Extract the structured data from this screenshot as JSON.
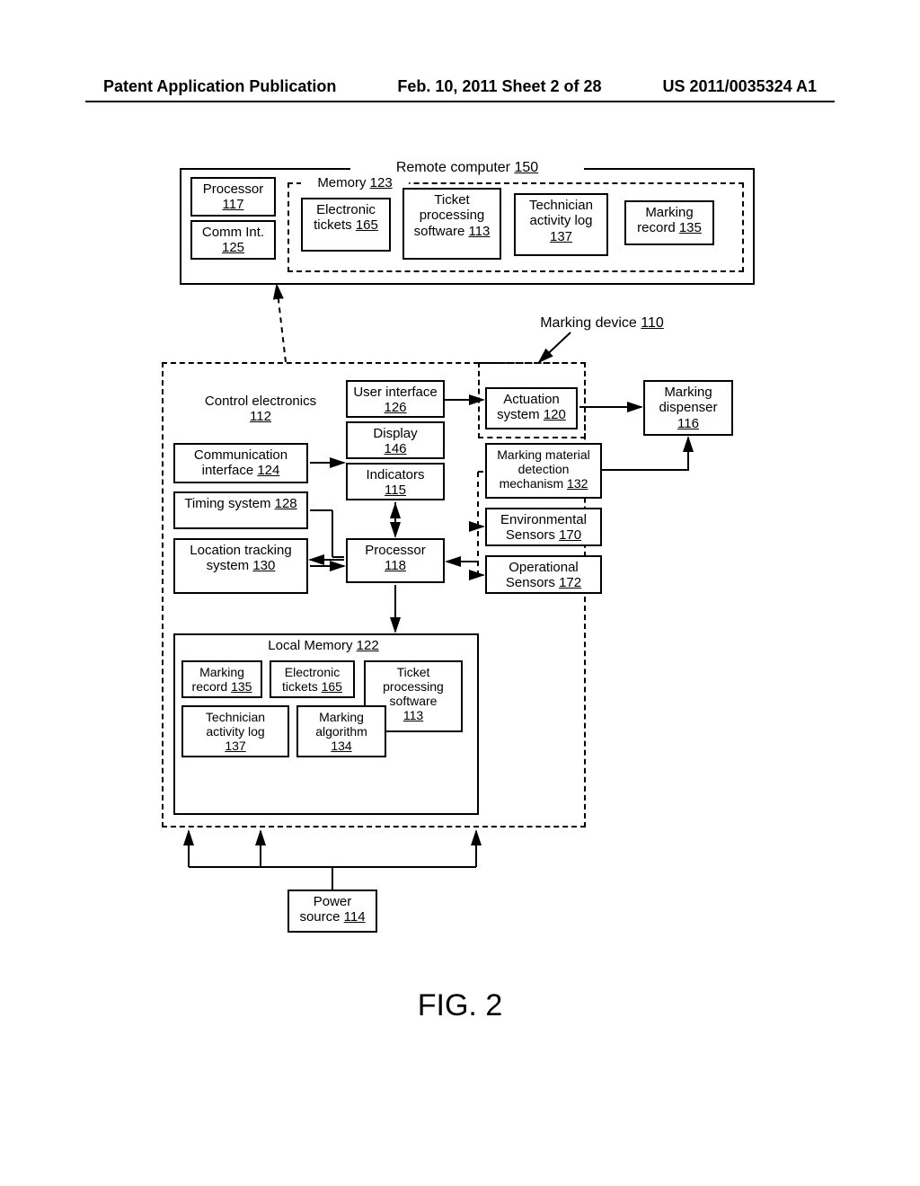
{
  "header": {
    "left": "Patent Application Publication",
    "center": "Feb. 10, 2011  Sheet 2 of 28",
    "right": "US 2011/0035324 A1"
  },
  "remote": {
    "title": "Remote computer ",
    "title_ref": "150",
    "processor": "Processor",
    "processor_ref": "117",
    "comm": "Comm Int.",
    "comm_ref": "125",
    "memory": "Memory ",
    "memory_ref": "123",
    "etickets": "Electronic tickets ",
    "etickets_ref": "165",
    "tps": "Ticket processing software ",
    "tps_ref": "113",
    "tal": "Technician activity log ",
    "tal_ref": "137",
    "mrec": "Marking record ",
    "mrec_ref": "135"
  },
  "device": {
    "title": "Marking device ",
    "title_ref": "110",
    "ce": "Control electronics ",
    "ce_ref": "112",
    "ci": "Communication interface ",
    "ci_ref": "124",
    "ts": "Timing system ",
    "ts_ref": "128",
    "lts": "Location tracking system ",
    "lts_ref": "130",
    "ui": "User interface ",
    "ui_ref": "126",
    "disp": "Display",
    "disp_ref": "146",
    "ind": "Indicators",
    "ind_ref": "115",
    "proc": "Processor",
    "proc_ref": "118",
    "act": "Actuation system ",
    "act_ref": "120",
    "mmd": "Marking material detection mechanism ",
    "mmd_ref": "132",
    "env": "Environmental Sensors ",
    "env_ref": "170",
    "ops": "Operational Sensors ",
    "ops_ref": "172",
    "md": "Marking dispenser",
    "md_ref": "116",
    "lm": "Local Memory ",
    "lm_ref": "122",
    "mrec": "Marking record ",
    "mrec_ref": "135",
    "etk": "Electronic tickets ",
    "etk_ref": "165",
    "tps": "Ticket processing software",
    "tps_ref": "113",
    "tal": "Technician activity log",
    "tal_ref": "137",
    "malg": "Marking algorithm",
    "malg_ref": "134",
    "ps": "Power source ",
    "ps_ref": "114"
  },
  "fig": "FIG. 2"
}
